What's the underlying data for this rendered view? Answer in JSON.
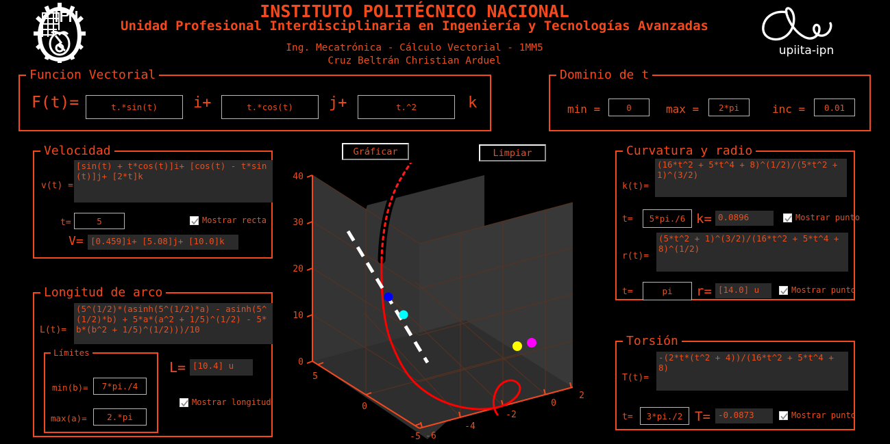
{
  "header": {
    "institute": "INSTITUTO POLITÉCNICO NACIONAL",
    "unit": "Unidad Profesional Interdisciplinaria en Ingeniería y Tecnologías Avanzadas",
    "course": "Ing. Mecatrónica - Cálculo Vectorial - 1MM5",
    "author": "Cruz Beltrán Christian Arduel",
    "left_logo_name": "ipn-logo",
    "right_logo_name": "upiita-logo",
    "right_logo_text": "upiita-ipn"
  },
  "colors": {
    "accent": "#f4481d",
    "text": "#e8501f",
    "background": "#000000",
    "readonly_bg": "#2b2b2b",
    "input_border": "#b8b8b8",
    "plot_bg": "#303030",
    "curve": "#ff0000"
  },
  "funcion_vectorial": {
    "legend": "Funcion Vectorial",
    "prefix": "F(t)=",
    "i_component": "t.*sin(t)",
    "sep_i": "i+",
    "j_component": "t.*cos(t)",
    "sep_j": "j+",
    "k_component": "t.^2",
    "sep_k": "k"
  },
  "dominio": {
    "legend": "Dominio de t",
    "min_label": "min =",
    "min_value": "0",
    "max_label": "max =",
    "max_value": "2*pi",
    "inc_label": "inc =",
    "inc_value": "0.01"
  },
  "buttons": {
    "graficar": "Gráficar",
    "limpiar": "Limpiar"
  },
  "velocidad": {
    "legend": "Velocidad",
    "vt_label": "v(t) =",
    "vt_expr": "[sin(t) + t*cos(t)]i+ [cos(t) - t*sin(t)]j+ [2*t]k",
    "t_label": "t=",
    "t_value": "5",
    "checkbox_label": "Mostrar recta",
    "checkbox_checked": true,
    "v_label": "V=",
    "v_value": "[0.459]i+ [5.08]j+ [10.0]k"
  },
  "longitud_arco": {
    "legend": "Longitud de arco",
    "lt_label": "L(t)=",
    "lt_expr": "(5^(1/2)*(asinh(5^(1/2)*a) - asinh(5^(1/2)*b) + 5*a*(a^2 + 1/5)^(1/2) - 5*b*(b^2 + 1/5)^(1/2)))/10",
    "limites_legend": "Límites",
    "min_label": "min(b)=",
    "min_value": "7*pi./4",
    "max_label": "max(a)=",
    "max_value": "2.*pi",
    "l_label": "L=",
    "l_value": "[10.4] u",
    "checkbox_label": "Mostrar longitud",
    "checkbox_checked": true
  },
  "curvatura": {
    "legend": "Curvatura y radio",
    "kt_label": "k(t)=",
    "kt_expr": "(16*t^2 + 5*t^4 + 8)^(1/2)/(5*t^2 + 1)^(3/2)",
    "k_t_label": "t=",
    "k_t_value": "5*pi./6",
    "k_label": "k=",
    "k_value": "0.0896",
    "k_checkbox_label": "Mostrar punto",
    "k_checkbox_checked": true,
    "rt_label": "r(t)=",
    "rt_expr": "(5*t^2 + 1)^(3/2)/(16*t^2 + 5*t^4 + 8)^(1/2)",
    "r_t_label": "t=",
    "r_t_value": "pi",
    "r_label": "r=",
    "r_value": "[14.0] u",
    "r_checkbox_label": "Mostrar punto",
    "r_checkbox_checked": true
  },
  "torsion": {
    "legend": "Torsión",
    "tt_label": "T(t)=",
    "tt_expr": "-(2*t*(t^2 + 4))/(16*t^2 + 5*t^4 + 8)",
    "t_label": "t=",
    "t_value": "3*pi./2",
    "T_label": "T=",
    "T_value": "-0.0873",
    "checkbox_label": "Mostrar punto",
    "checkbox_checked": true
  },
  "chart_data": {
    "type": "line",
    "title": "",
    "xlabel": "",
    "ylabel": "",
    "zlabel": "",
    "grid": true,
    "legend_position": "none",
    "projection": "3d",
    "axes": {
      "x": {
        "ticks": [
          5,
          0,
          -5
        ],
        "range": [
          -6.5,
          6.5
        ]
      },
      "y": {
        "ticks": [
          -6,
          -4,
          -2,
          0,
          2
        ],
        "range": [
          -7,
          3
        ]
      },
      "z": {
        "ticks": [
          0,
          10,
          20,
          30,
          40
        ],
        "range": [
          0,
          44
        ]
      }
    },
    "series": [
      {
        "name": "r(t) = [t*sin(t), t*cos(t), t^2]",
        "color": "#ff0000",
        "style": "solid",
        "width": 3
      },
      {
        "name": "tangent line at t=5",
        "color": "#ffffff",
        "style": "dashed",
        "width": 4
      },
      {
        "name": "arc length segment",
        "color": "#000000",
        "style": "thick-dotted-red",
        "width": 9
      }
    ],
    "markers": [
      {
        "name": "curvature-point",
        "color": "#0000ff",
        "t": "5*pi./6"
      },
      {
        "name": "radius-point",
        "color": "#00ffff",
        "t": "pi"
      },
      {
        "name": "torsion-point",
        "color": "#ffff00",
        "t": "3*pi./2"
      },
      {
        "name": "end-point",
        "color": "#ff00ff",
        "t": "2*pi"
      }
    ]
  }
}
